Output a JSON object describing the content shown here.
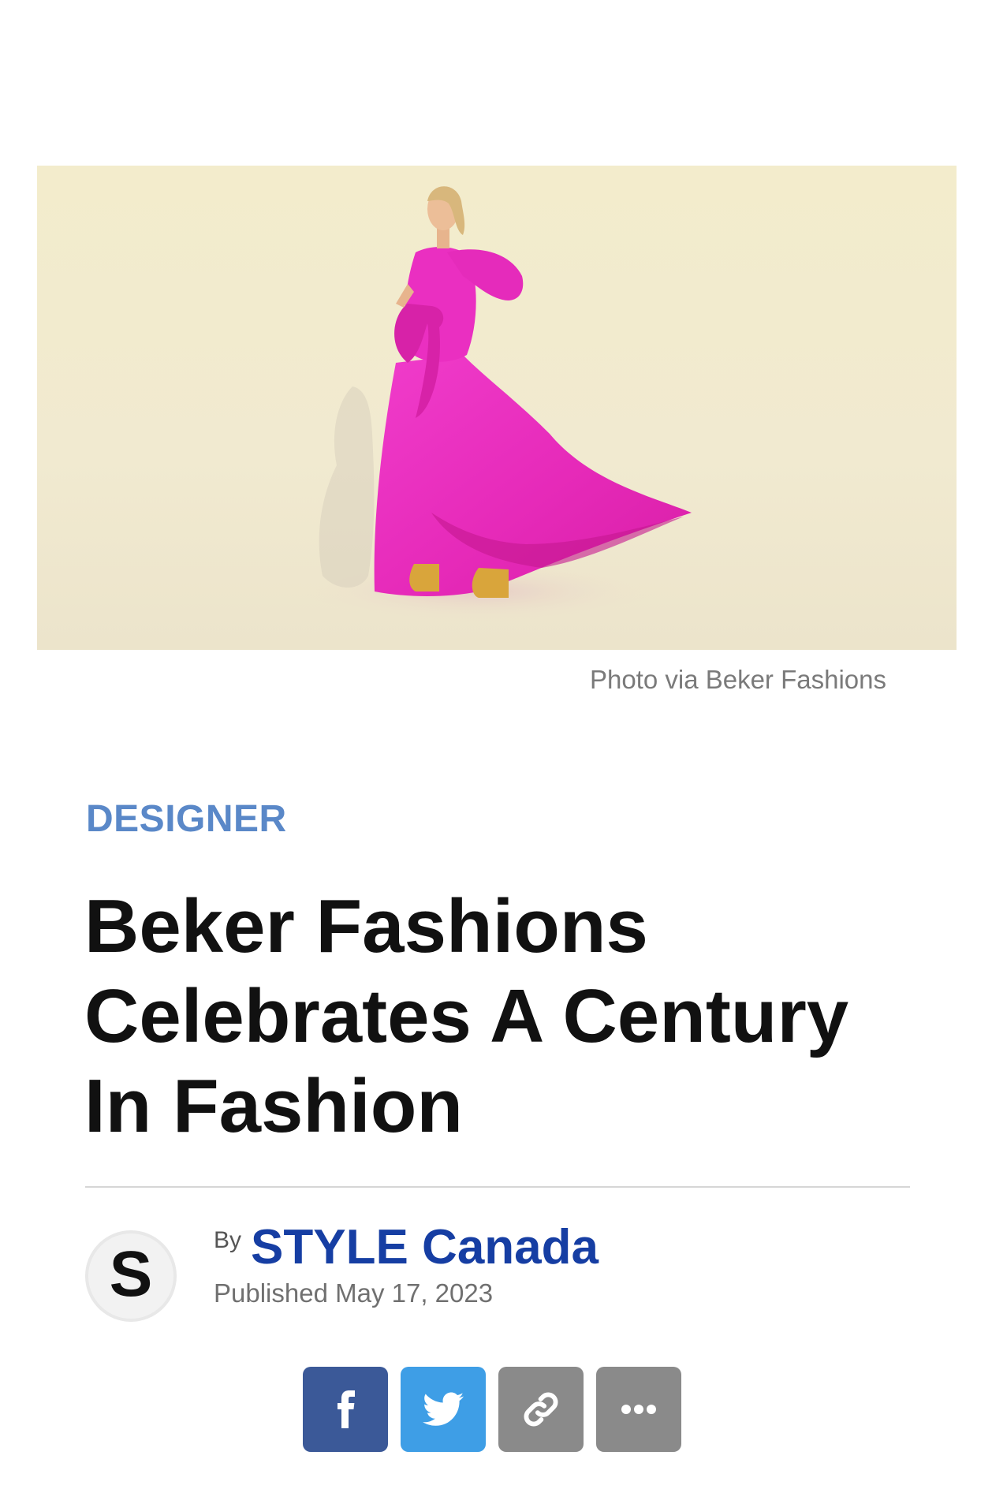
{
  "hero": {
    "caption": "Photo via Beker Fashions",
    "background_color": "#f2ebcf",
    "dress_color": "#ec2fc2"
  },
  "article": {
    "category": "DESIGNER",
    "headline": "Beker Fashions Celebrates A Century In Fashion"
  },
  "author": {
    "avatar_letter": "S",
    "by_label": "By",
    "name": "STYLE Canada",
    "published": "Published May 17, 2023"
  },
  "share": {
    "buttons": [
      {
        "icon": "facebook-icon",
        "color": "#3b5998"
      },
      {
        "icon": "twitter-icon",
        "color": "#3e9ee6"
      },
      {
        "icon": "link-icon",
        "color": "#8a8a8a"
      },
      {
        "icon": "more-icon",
        "color": "#8a8a8a"
      }
    ]
  }
}
